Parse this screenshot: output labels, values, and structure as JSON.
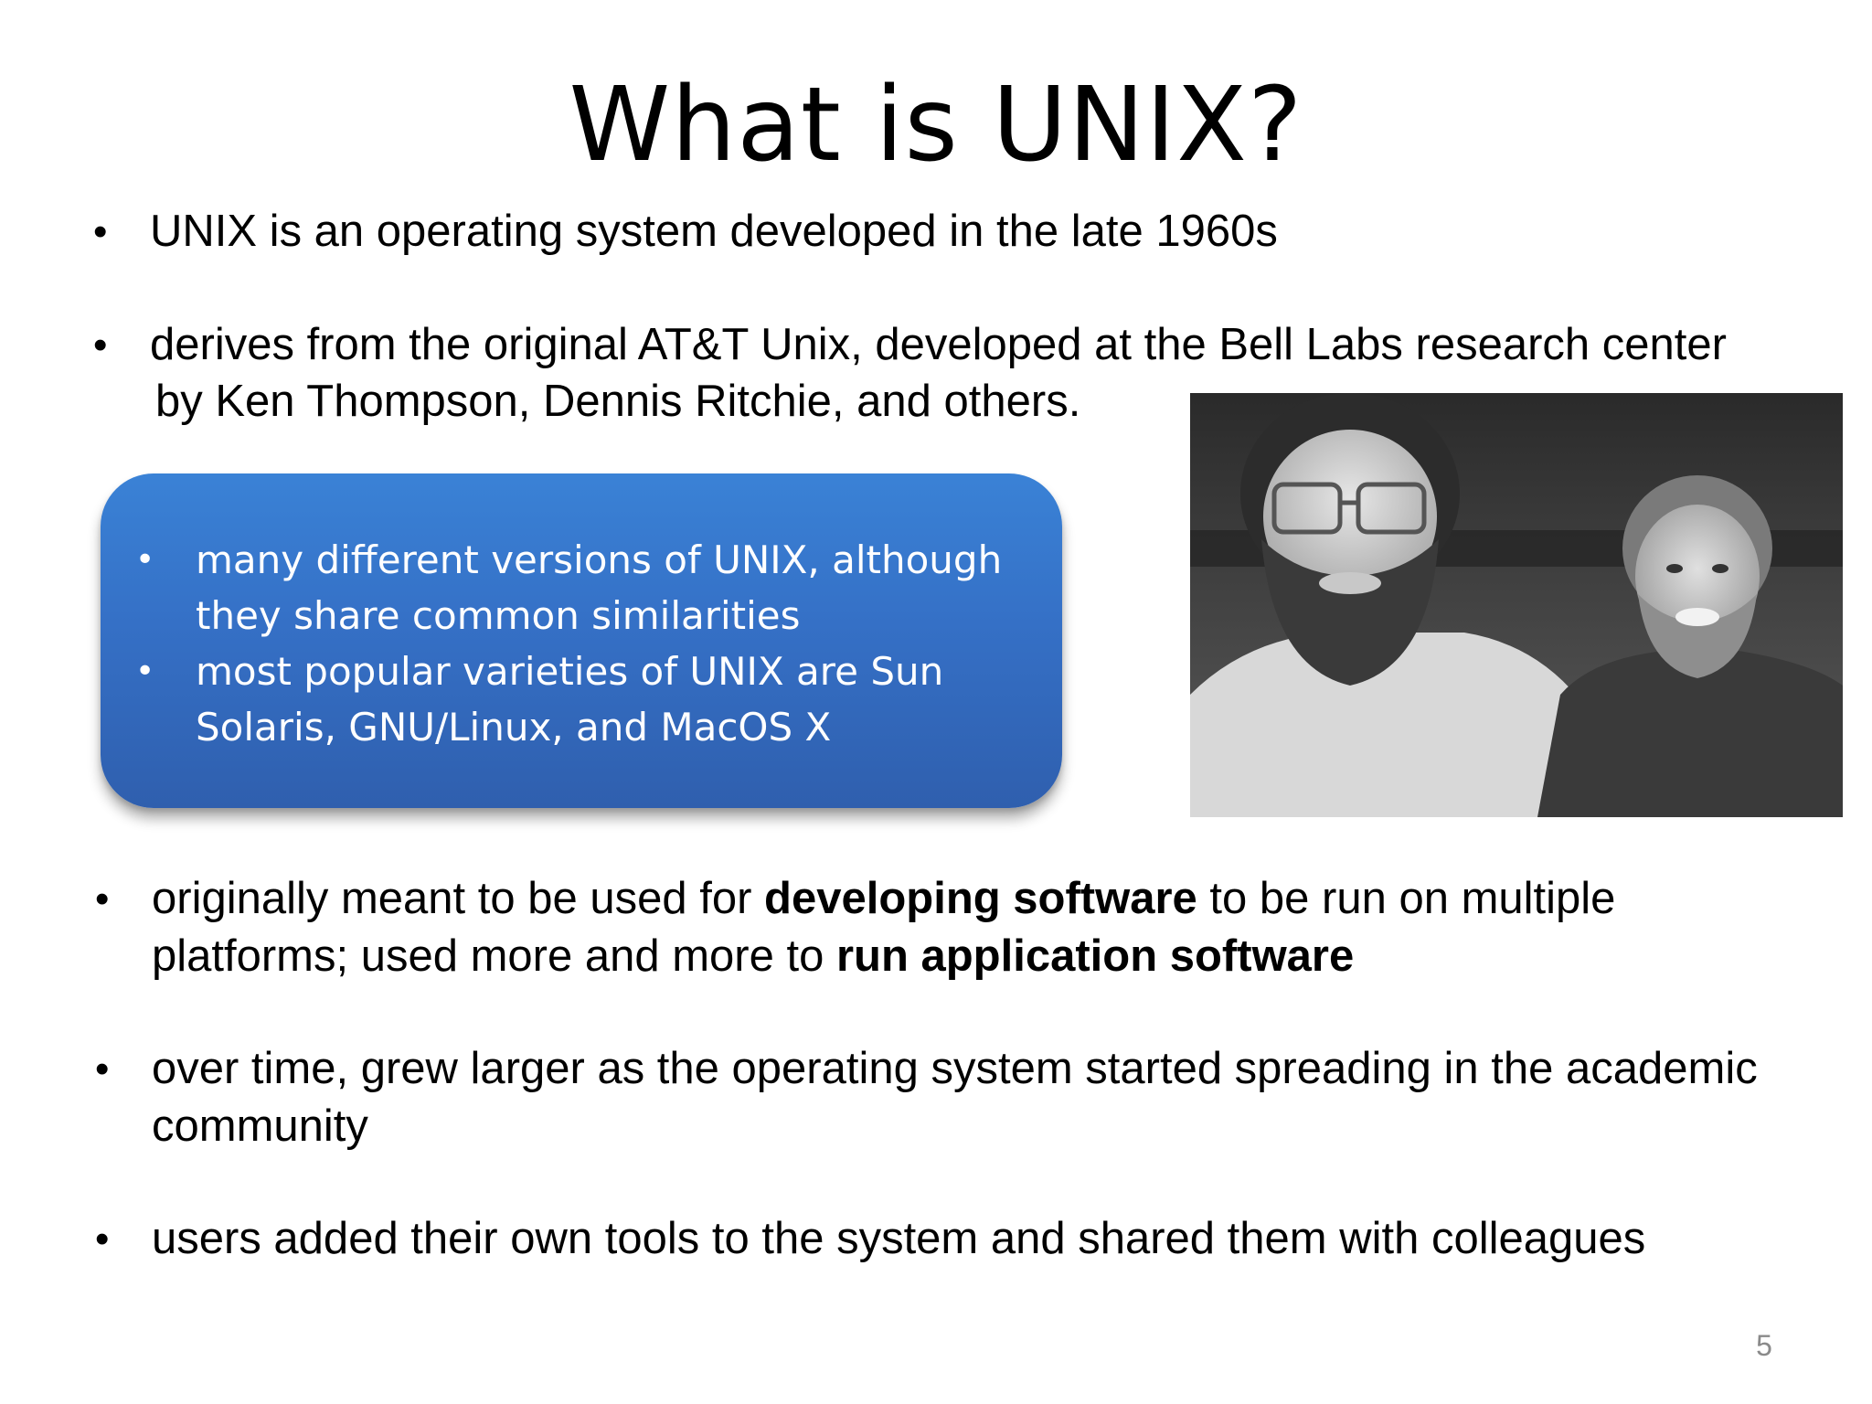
{
  "slide": {
    "title": "What is UNIX?",
    "page_number": "5"
  },
  "bullets": {
    "marker": "•",
    "b1": "UNIX is an operating system developed in the late 1960s",
    "b2_line1": "derives from the original AT&T Unix, developed at the Bell Labs research center",
    "b2_line2": "by Ken Thompson, Dennis Ritchie, and others.",
    "b3_part1": "originally meant to be used for ",
    "b3_bold1": "developing software",
    "b3_part2": " to be run on multiple platforms; used more and more to ",
    "b3_bold2": "run application software",
    "b4": "over time, grew larger as the operating system started spreading in the academic community",
    "b5": "users added their own tools to the system and shared them with colleagues"
  },
  "callout": {
    "items": [
      "many different versions of UNIX, although they share common similarities",
      "most popular varieties of UNIX are Sun Solaris, GNU/Linux, and MacOS X"
    ],
    "color": "#3570c6"
  },
  "photo": {
    "style": "black-and-white"
  }
}
